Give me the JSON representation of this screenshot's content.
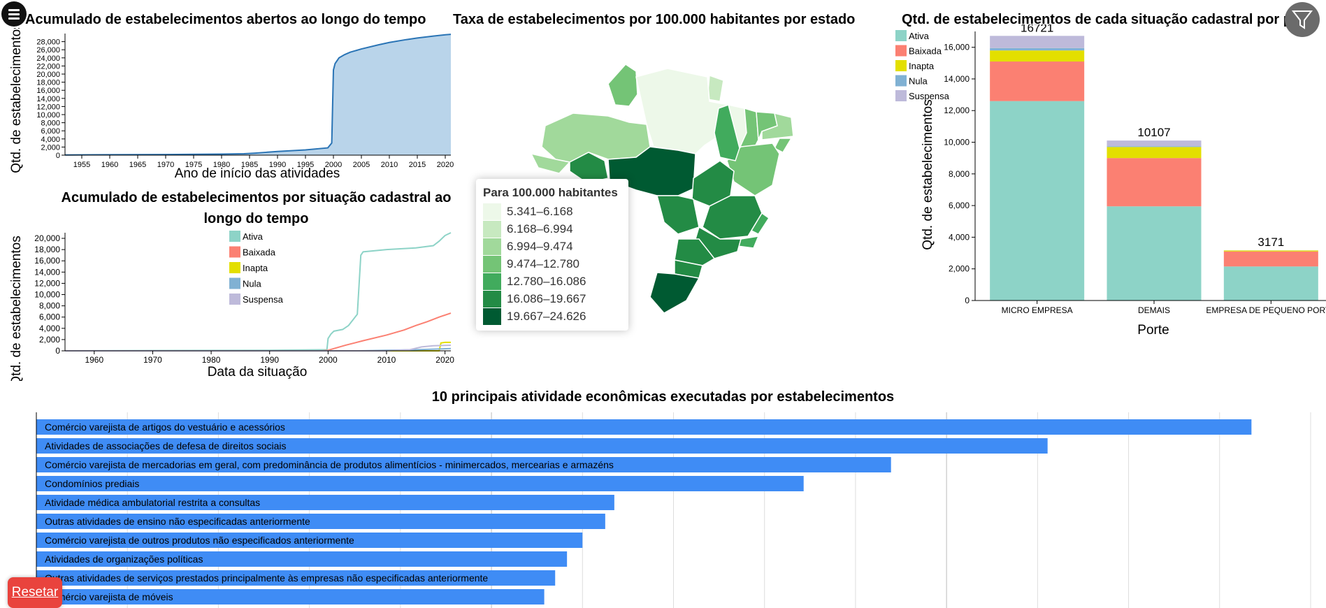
{
  "menu_icon": "hamburger-menu-icon",
  "filter_icon": "funnel-filter-icon",
  "reset_label": "Resetar",
  "colors": {
    "area_fill": "#b9d4ea",
    "area_line": "#2a74b5",
    "bar_blue": "#3f8cf5",
    "status": {
      "Ativa": "#8dd3c7",
      "Baixada": "#fb8072",
      "Inapta": "#e3df00",
      "Nula": "#80b1d3",
      "Suspensa": "#bebada"
    },
    "map_scale": [
      "#edf8e9",
      "#c7e9c0",
      "#a1d99b",
      "#74c476",
      "#41ab5d",
      "#238b45",
      "#005a32"
    ]
  },
  "chart1": {
    "title": "Acumulado de estabelecimentos abertos ao longo do tempo",
    "xlabel": "Ano de início das atividades",
    "ylabel": "Qtd. de estabelecimentos",
    "chart_data": {
      "type": "area",
      "xlim": [
        1952,
        2021
      ],
      "ylim": [
        0,
        30000
      ],
      "xticks": [
        1955,
        1960,
        1965,
        1970,
        1975,
        1980,
        1985,
        1990,
        1995,
        2000,
        2005,
        2010,
        2015,
        2020
      ],
      "yticks": [
        0,
        2000,
        4000,
        6000,
        8000,
        10000,
        12000,
        14000,
        16000,
        18000,
        20000,
        22000,
        24000,
        26000,
        28000
      ],
      "x": [
        1952,
        1960,
        1970,
        1980,
        1984,
        1986,
        1988,
        1990,
        1995,
        1999,
        1999.7,
        2000,
        2000.3,
        2001,
        2002,
        2003,
        2005,
        2008,
        2010,
        2013,
        2015,
        2018,
        2020,
        2021
      ],
      "y": [
        50,
        100,
        150,
        250,
        350,
        500,
        700,
        900,
        1300,
        1800,
        3000,
        21000,
        22600,
        24000,
        24800,
        25400,
        26200,
        27200,
        27800,
        28500,
        28900,
        29400,
        29700,
        29800
      ]
    }
  },
  "chart2": {
    "title_line1": "Acumulado de estabelecimentos por situação cadastral ao",
    "title_line2": "longo do tempo",
    "xlabel": "Data da situação",
    "ylabel": "Qtd. de estabelecimentos",
    "chart_data": {
      "type": "line",
      "xlim": [
        1955,
        2021
      ],
      "ylim": [
        0,
        21000
      ],
      "xticks": [
        1960,
        1970,
        1980,
        1990,
        2000,
        2010,
        2020
      ],
      "yticks": [
        0,
        2000,
        4000,
        6000,
        8000,
        10000,
        12000,
        14000,
        16000,
        18000,
        20000
      ],
      "series": [
        {
          "name": "Ativa",
          "x": [
            1955,
            1990,
            1999.8,
            2000,
            2000.5,
            2001,
            2002.5,
            2003.5,
            2005,
            2005.6,
            2006,
            2008,
            2010,
            2015,
            2018,
            2019,
            2020,
            2021
          ],
          "y": [
            0,
            100,
            200,
            2200,
            3000,
            3500,
            3800,
            4500,
            6500,
            17000,
            17600,
            17800,
            18000,
            18300,
            18700,
            19500,
            20500,
            21000
          ]
        },
        {
          "name": "Baixada",
          "x": [
            1955,
            1999,
            2000,
            2003,
            2006,
            2010,
            2013,
            2015,
            2017,
            2019,
            2021
          ],
          "y": [
            0,
            0,
            100,
            1000,
            1800,
            2800,
            3700,
            4500,
            5200,
            6000,
            6700
          ]
        },
        {
          "name": "Inapta",
          "x": [
            1955,
            2018,
            2019,
            2019.3,
            2020,
            2021
          ],
          "y": [
            0,
            0,
            0,
            1400,
            1500,
            1500
          ]
        },
        {
          "name": "Nula",
          "x": [
            1955,
            2005,
            2010,
            2015,
            2018,
            2021
          ],
          "y": [
            0,
            0,
            100,
            200,
            300,
            400
          ]
        },
        {
          "name": "Suspensa",
          "x": [
            1955,
            2010,
            2014,
            2016,
            2018,
            2021
          ],
          "y": [
            0,
            0,
            200,
            700,
            900,
            1000
          ]
        }
      ]
    }
  },
  "map": {
    "title": "Taxa de estabelecimentos por 100.000 habitantes por estado",
    "legend_title": "Para 100.000 habitantes",
    "legend_items": [
      "5.341–6.168",
      "6.168–6.994",
      "6.994–9.474",
      "9.474–12.780",
      "12.780–16.086",
      "16.086–19.667",
      "19.667–24.626"
    ]
  },
  "chart3": {
    "title": "Qtd. de estabelecimentos de cada situação cadastral por porte",
    "xlabel": "Porte",
    "ylabel": "Qtd. de estabelecimentos",
    "chart_data": {
      "type": "bar",
      "stacked": true,
      "categories": [
        "MICRO EMPRESA",
        "DEMAIS",
        "EMPRESA DE PEQUENO PORTE"
      ],
      "ylim": [
        0,
        17000
      ],
      "yticks": [
        0,
        2000,
        4000,
        6000,
        8000,
        10000,
        12000,
        14000,
        16000
      ],
      "totals": [
        16721,
        10107,
        3171
      ],
      "series": [
        {
          "name": "Ativa",
          "values": [
            12600,
            5950,
            2150
          ]
        },
        {
          "name": "Baixada",
          "values": [
            2500,
            3050,
            950
          ]
        },
        {
          "name": "Inapta",
          "values": [
            700,
            700,
            60
          ]
        },
        {
          "name": "Nula",
          "values": [
            150,
            50,
            1
          ]
        },
        {
          "name": "Suspensa",
          "values": [
            771,
            357,
            10
          ]
        }
      ]
    }
  },
  "chart4": {
    "title": "10 principais atividade econômicas executadas por estabelecimentos",
    "chart_data": {
      "type": "bar",
      "orientation": "horizontal",
      "categories": [
        "Comércio varejista de artigos do vestuário e acessórios",
        "Atividades de associações de defesa de direitos sociais",
        "Comércio varejista de mercadorias em geral, com predominância de produtos alimentícios - minimercados, mercearias e armazéns",
        "Condomínios prediais",
        "Atividade médica ambulatorial restrita a consultas",
        "Outras atividades de ensino não especificadas anteriormente",
        "Comércio varejista de outros produtos não especificados anteriormente",
        "Atividades de organizações políticas",
        "Outras atividades de serviços prestados principalmente às empresas não especificadas anteriormente",
        "Comércio varejista de móveis"
      ],
      "values": [
        1335,
        1111,
        939,
        843,
        635,
        625,
        600,
        583,
        570,
        558
      ],
      "xlim": [
        0,
        1400
      ],
      "gridstep": 100
    }
  }
}
